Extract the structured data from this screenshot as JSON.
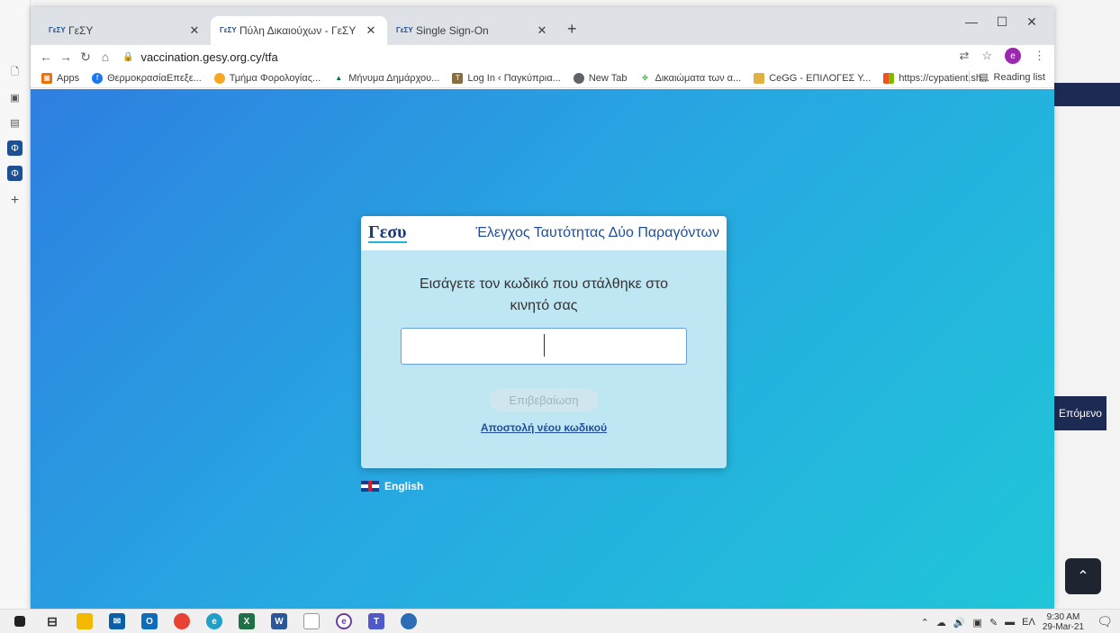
{
  "tabs": [
    {
      "label": "ΓεΣΥ",
      "favicon": "ΓεΣΥ"
    },
    {
      "label": "Πύλη Δικαιούχων - ΓεΣΥ",
      "favicon": "ΓεΣΥ"
    },
    {
      "label": "Single Sign-On",
      "favicon": "ΓεΣΥ"
    }
  ],
  "url": "vaccination.gesy.org.cy/tfa",
  "bookmarks": [
    {
      "label": "Apps",
      "icon": "apps-grid-icon",
      "color": "#e8710a"
    },
    {
      "label": "ΘερμοκρασίαΕπεξε...",
      "icon": "facebook-icon",
      "color": "#1877f2"
    },
    {
      "label": "Τμήμα Φορολογίας...",
      "icon": "tax-dept-icon",
      "color": "#f5a623"
    },
    {
      "label": "Μήνυμα Δημάρχου...",
      "icon": "mountain-icon",
      "color": "#0b6b3a"
    },
    {
      "label": "Log In ‹ Παγκύπρια...",
      "icon": "wp-icon",
      "color": "#8a6d3b"
    },
    {
      "label": "New Tab",
      "icon": "globe-icon",
      "color": "#5f6368"
    },
    {
      "label": "Δικαιώματα των α...",
      "icon": "rights-icon",
      "color": "#4caf50"
    },
    {
      "label": "CeGG - ΕΠΙΛΟΓΕΣ Υ...",
      "icon": "shield-icon",
      "color": "#e0b040"
    },
    {
      "label": "https://cypatient.sh...",
      "icon": "ms-icon",
      "color": "#f25022"
    }
  ],
  "reading_list": "Reading list",
  "profile_initial": "e",
  "card": {
    "logo": "Γεσυ",
    "title": "Έλεγχος Ταυτότητας Δύο Παραγόντων",
    "prompt_line1": "Εισάγετε τον κωδικό που στάλθηκε στο",
    "prompt_line2": "κινητό σας",
    "code_value": "",
    "confirm_label": "Επιβεβαίωση",
    "resend_label": "Αποστολή νέου κωδικού"
  },
  "language": "English",
  "side": {
    "next_label": "Επόμενο"
  },
  "taskbar": {
    "time": "9:30 AM",
    "date": "29-Mar-21",
    "lang": "ΕΛ"
  }
}
